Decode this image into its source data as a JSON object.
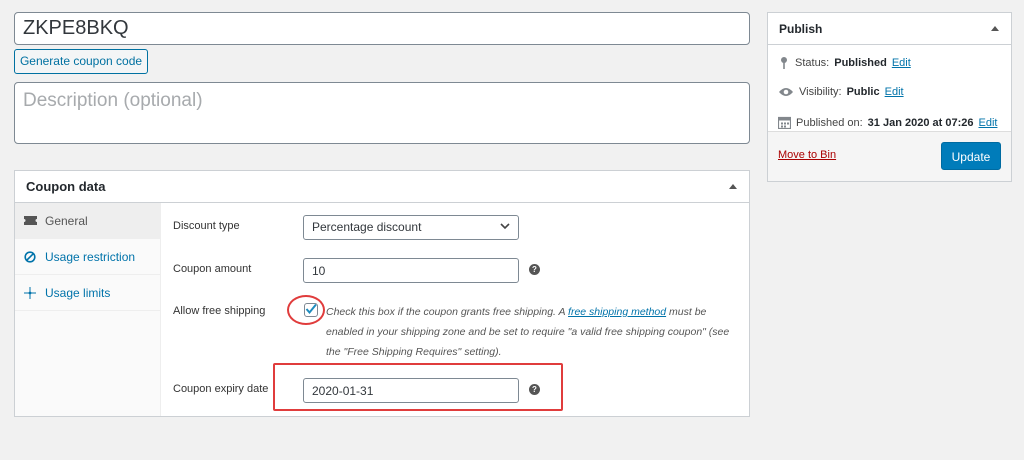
{
  "coupon": {
    "code": "ZKPE8BKQ",
    "generate_label": "Generate coupon code",
    "description_placeholder": "Description (optional)"
  },
  "coupon_data": {
    "title": "Coupon data",
    "tabs": [
      {
        "label": "General",
        "icon": "ticket-icon",
        "active": true
      },
      {
        "label": "Usage restriction",
        "icon": "ban-icon",
        "active": false
      },
      {
        "label": "Usage limits",
        "icon": "arrows-icon",
        "active": false
      }
    ],
    "fields": {
      "discount_type_label": "Discount type",
      "discount_type_value": "Percentage discount",
      "amount_label": "Coupon amount",
      "amount_value": "10",
      "free_shipping_label": "Allow free shipping",
      "free_shipping_checked": true,
      "free_shipping_desc_pre": "Check this box if the coupon grants free shipping. A ",
      "free_shipping_link": "free shipping method",
      "free_shipping_desc_post": " must be enabled in your shipping zone and be set to require \"a valid free shipping coupon\" (see the \"Free Shipping Requires\" setting).",
      "expiry_label": "Coupon expiry date",
      "expiry_value": "2020-01-31"
    },
    "help_glyph": "?"
  },
  "publish": {
    "title": "Publish",
    "status_label": "Status:",
    "status_value": "Published",
    "visibility_label": "Visibility:",
    "visibility_value": "Public",
    "published_label": "Published on:",
    "published_value": "31 Jan 2020 at 07:26",
    "edit_label": "Edit",
    "move_to_bin": "Move to Bin",
    "update_label": "Update"
  },
  "colors": {
    "accent": "#0071a1",
    "primary_button": "#007cba",
    "highlight": "#e03c3c",
    "trash": "#a00"
  }
}
